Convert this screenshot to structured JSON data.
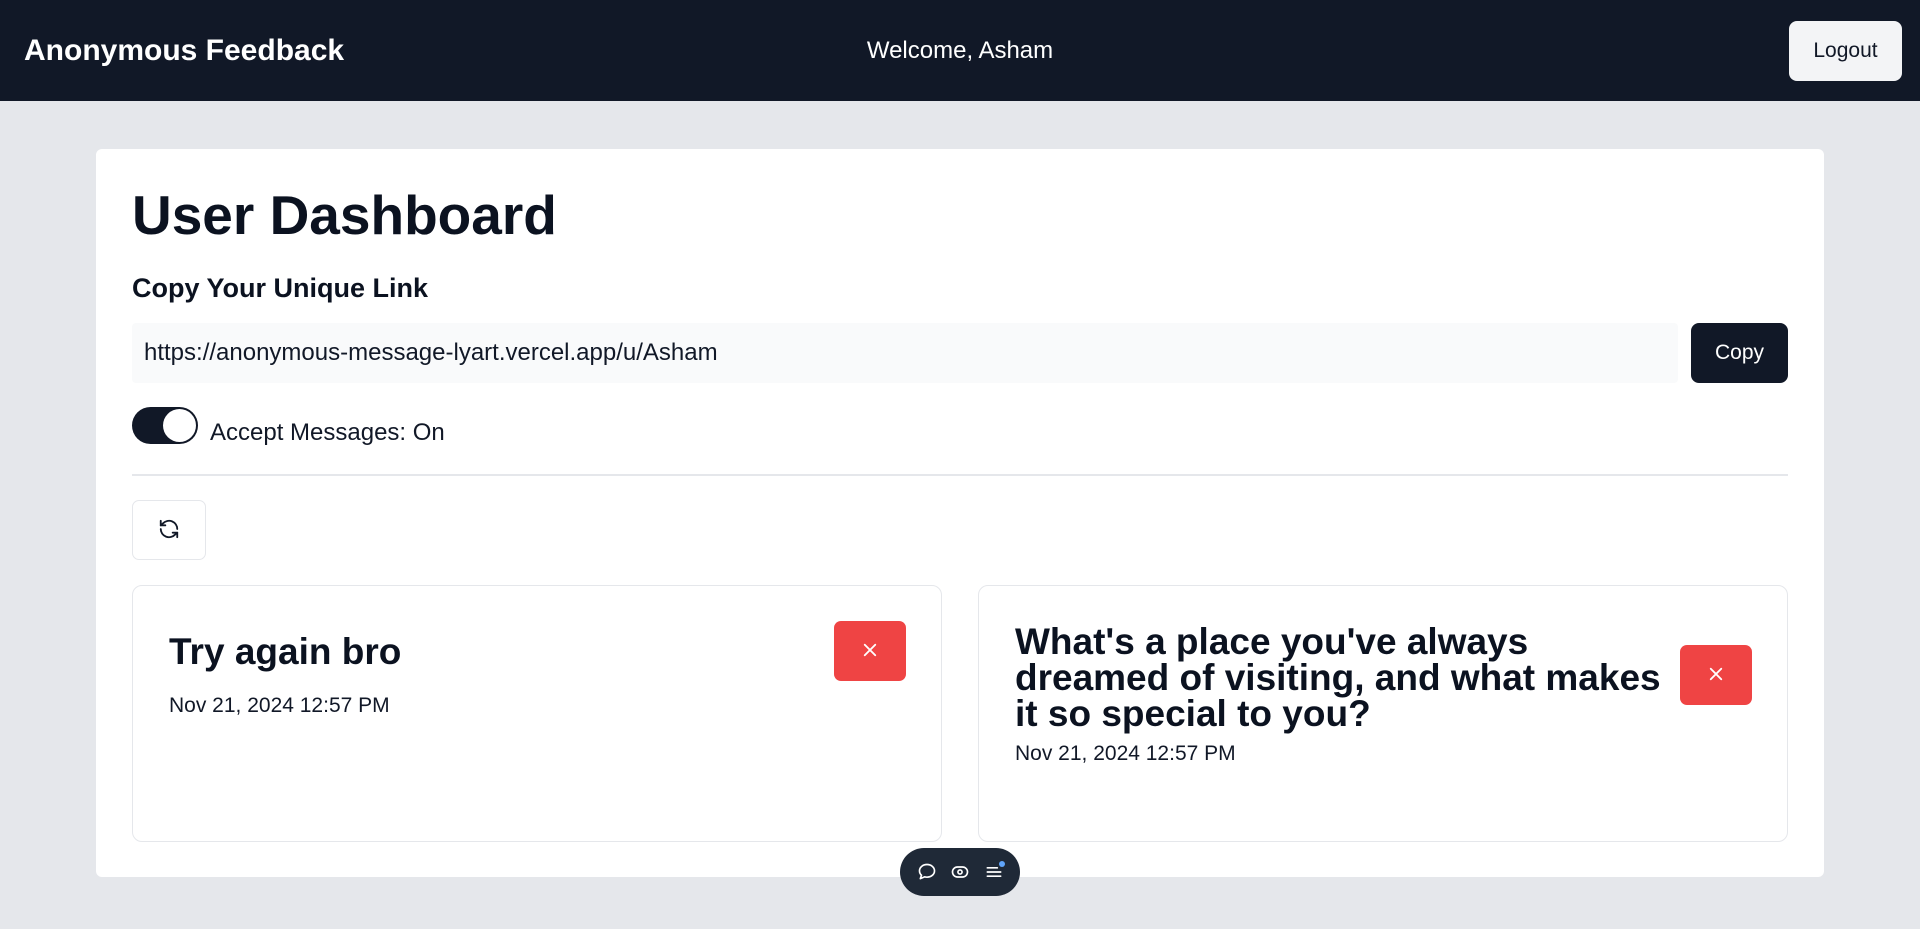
{
  "navbar": {
    "brand": "Anonymous Feedback",
    "welcome": "Welcome, Asham",
    "logout_label": "Logout"
  },
  "dashboard": {
    "title": "User Dashboard",
    "link_heading": "Copy Your Unique Link",
    "link_value": "https://anonymous-message-lyart.vercel.app/u/Asham",
    "copy_label": "Copy",
    "accept_label": "Accept Messages: On",
    "accept_on": true
  },
  "messages": [
    {
      "content": "Try again bro",
      "date": "Nov 21, 2024 12:57 PM"
    },
    {
      "content": "What's a place you've always dreamed of visiting, and what makes it so special to you?",
      "date": "Nov 21, 2024 12:57 PM"
    }
  ],
  "icons": {
    "refresh": "refresh-icon",
    "delete": "x-icon",
    "toolbar": [
      "comment-icon",
      "eye-toggle-icon",
      "menu-icon"
    ]
  },
  "colors": {
    "navbar_bg": "#111827",
    "delete_red": "#ef4444",
    "page_bg": "#e5e7eb"
  }
}
